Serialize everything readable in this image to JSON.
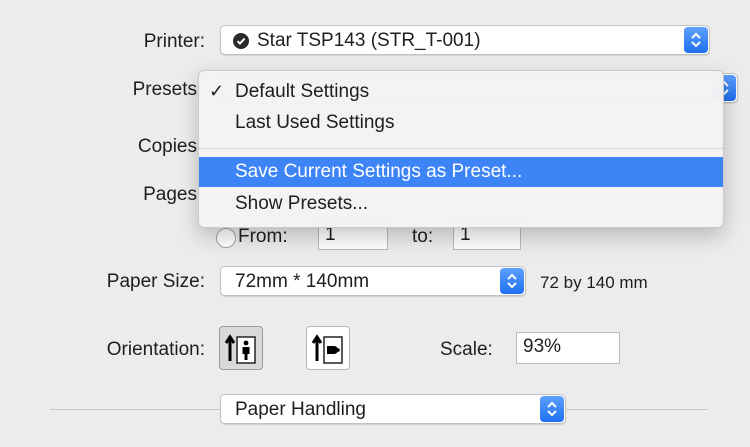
{
  "printer": {
    "label": "Printer:",
    "value": "Star TSP143 (STR_T-001)",
    "icon": "printer-status-icon"
  },
  "presets": {
    "label": "Presets",
    "menu_items": [
      {
        "label": "Default Settings",
        "checked": true
      },
      {
        "label": "Last Used Settings",
        "checked": false
      },
      {
        "label": "Save Current Settings as Preset...",
        "highlighted": true
      },
      {
        "label": "Show Presets..."
      }
    ]
  },
  "copies": {
    "label": "Copies"
  },
  "pages": {
    "label": "Pages",
    "from_label": "From:",
    "from_value": "1",
    "to_label": "to:",
    "to_value": "1"
  },
  "paper_size": {
    "label": "Paper Size:",
    "value": "72mm * 140mm",
    "dimensions": "72 by 140 mm"
  },
  "orientation": {
    "label": "Orientation:",
    "selected": "portrait"
  },
  "scale": {
    "label": "Scale:",
    "value": "93%"
  },
  "section_popup": {
    "value": "Paper Handling"
  },
  "colors": {
    "accent": "#3d84f7",
    "stepper": "#1f6ff0"
  }
}
